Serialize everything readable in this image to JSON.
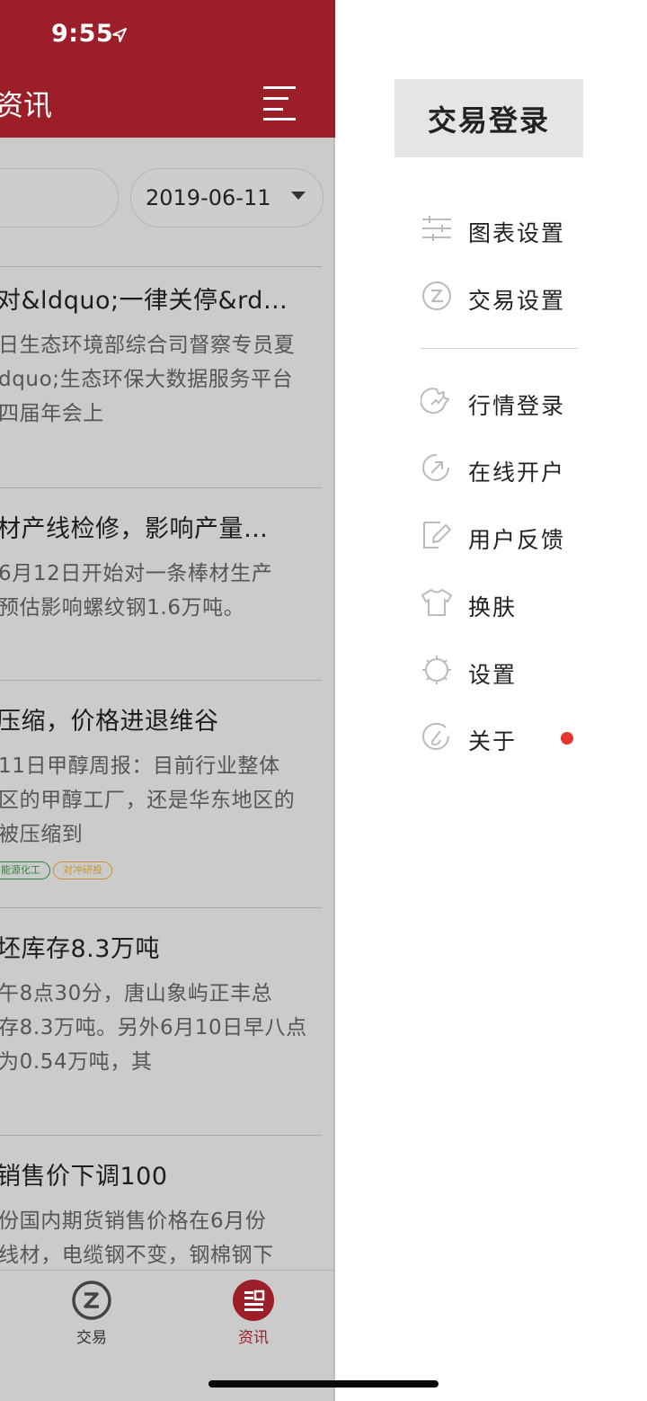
{
  "status_bar": {
    "time": "9:55"
  },
  "header": {
    "title": "资讯"
  },
  "filters": {
    "date": "2019-06-11"
  },
  "news": [
    {
      "title": "对&ldquo;一律关停&rd…",
      "lines": [
        "日生态环境部综合司督察专员夏",
        "dquo;生态环保大数据服务平台",
        "四届年会上"
      ],
      "tags": []
    },
    {
      "title": "材产线检修，影响产量…",
      "lines": [
        "6月12日开始对一条棒材生产",
        "预估影响螺纹钢1.6万吨。"
      ],
      "tags": []
    },
    {
      "title": "压缩，价格进退维谷",
      "lines": [
        "11日甲醇周报：目前行业整体",
        "区的甲醇工厂，还是华东地区的",
        "被压缩到"
      ],
      "tags": [
        "能源化工",
        "对冲研投"
      ]
    },
    {
      "title": "坯库存8.3万吨",
      "lines": [
        "午8点30分，唐山象屿正丰总",
        "存8.3万吨。另外6月10日早八点",
        "为0.54万吨，其"
      ],
      "tags": []
    },
    {
      "title": "销售价下调100",
      "lines": [
        "份国内期货销售价格在6月份",
        "线材，电缆钢不变，钢棉钢下"
      ],
      "tags": []
    }
  ],
  "tabbar": {
    "trade_label": "交易",
    "news_label": "资讯"
  },
  "drawer": {
    "login_label": "交易登录",
    "menu": [
      {
        "label": "图表设置",
        "icon": "chart-settings-icon"
      },
      {
        "label": "交易设置",
        "icon": "trade-settings-icon"
      },
      {
        "label": "行情登录",
        "icon": "market-login-icon"
      },
      {
        "label": "在线开户",
        "icon": "open-account-icon"
      },
      {
        "label": "用户反馈",
        "icon": "feedback-icon"
      },
      {
        "label": "换肤",
        "icon": "skin-icon"
      },
      {
        "label": "设置",
        "icon": "gear-icon"
      },
      {
        "label": "关于",
        "icon": "about-icon"
      }
    ]
  },
  "colors": {
    "brand": "#9c1e28",
    "badge_dot": "#e5352f",
    "drawer_bg": "#ffffff"
  }
}
